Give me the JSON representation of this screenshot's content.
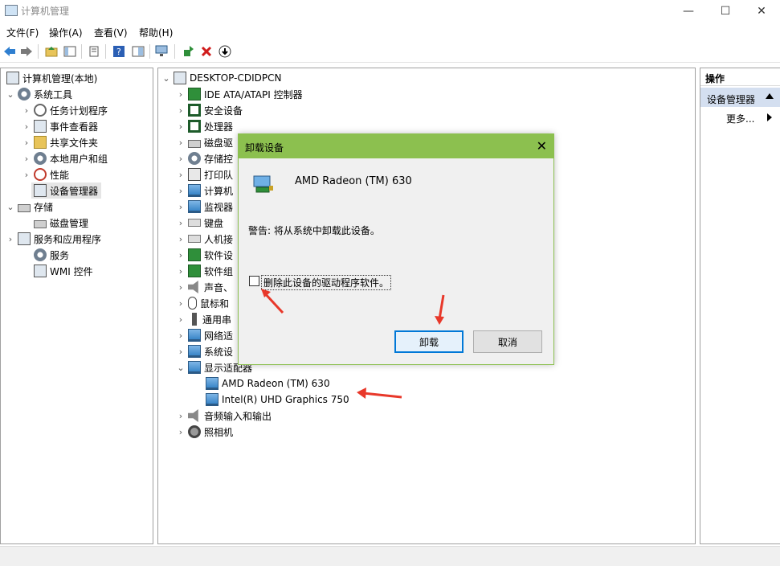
{
  "window": {
    "title": "计算机管理",
    "minimize": "—",
    "maximize": "☐",
    "close": "✕"
  },
  "menu": [
    "文件(F)",
    "操作(A)",
    "查看(V)",
    "帮助(H)"
  ],
  "left_tree": {
    "root": "计算机管理(本地)",
    "system_tools": "系统工具",
    "task_scheduler": "任务计划程序",
    "event_viewer": "事件查看器",
    "shared_folders": "共享文件夹",
    "local_users": "本地用户和组",
    "performance": "性能",
    "device_manager": "设备管理器",
    "storage": "存储",
    "disk_management": "磁盘管理",
    "services_apps": "服务和应用程序",
    "services": "服务",
    "wmi": "WMI 控件"
  },
  "device_tree": {
    "root": "DESKTOP-CDIDPCN",
    "categories": [
      "IDE ATA/ATAPI 控制器",
      "安全设备",
      "处理器",
      "磁盘驱",
      "存储控",
      "打印队",
      "计算机",
      "监视器",
      "键盘",
      "人机接",
      "软件设",
      "软件组",
      "声音、",
      "鼠标和",
      "通用串",
      "网络适",
      "系统设",
      "显示适配器"
    ],
    "display_adapters": [
      "AMD Radeon (TM) 630",
      "Intel(R) UHD Graphics 750"
    ],
    "after": [
      "音频输入和输出",
      "照相机"
    ]
  },
  "actions": {
    "header": "操作",
    "selected": "设备管理器",
    "more": "更多..."
  },
  "dialog": {
    "title": "卸载设备",
    "device_name": "AMD Radeon (TM) 630",
    "warning": "警告: 将从系统中卸载此设备。",
    "checkbox_label": "删除此设备的驱动程序软件。",
    "checkbox_checked": false,
    "uninstall_button": "卸载",
    "cancel_button": "取消"
  },
  "colors": {
    "dialog_accent": "#8cc04f",
    "annotation_arrow": "#e8382a",
    "selection": "#e5e5e5"
  }
}
